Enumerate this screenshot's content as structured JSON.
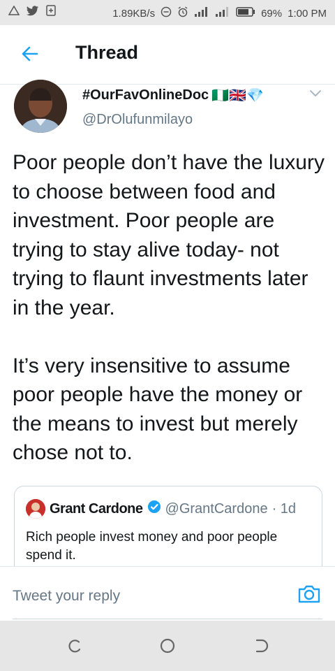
{
  "status_bar": {
    "net_speed": "1.89KB/s",
    "battery": "69%",
    "time": "1:00 PM",
    "icons": [
      "warning-icon",
      "twitter-icon",
      "save-icon",
      "dnd-icon",
      "alarm-icon",
      "signal-icon",
      "signal-icon",
      "battery-icon"
    ]
  },
  "header": {
    "title": "Thread",
    "back_icon": "arrow-left-icon"
  },
  "tweet": {
    "author_name": "#OurFavOnlineDoc",
    "flags": "🇳🇬🇬🇧💎",
    "handle": "@DrOlufunmilayo",
    "paragraphs": [
      "Poor people don’t have the luxury to choose between food and investment. Poor people are trying to stay alive today- not trying to flaunt investments later in the year.",
      "It’s very insensitive to assume poor people have the money or the means to invest but merely chose not to."
    ]
  },
  "quoted_tweet": {
    "author_name": "Grant Cardone",
    "handle": "@GrantCardone",
    "time": "· 1d",
    "text": "Rich people invest money and poor people spend it."
  },
  "reply": {
    "placeholder": "Tweet your reply"
  },
  "colors": {
    "accent": "#1da1f2",
    "text": "#14171a",
    "muted": "#657786",
    "border": "#e1e8ed"
  }
}
